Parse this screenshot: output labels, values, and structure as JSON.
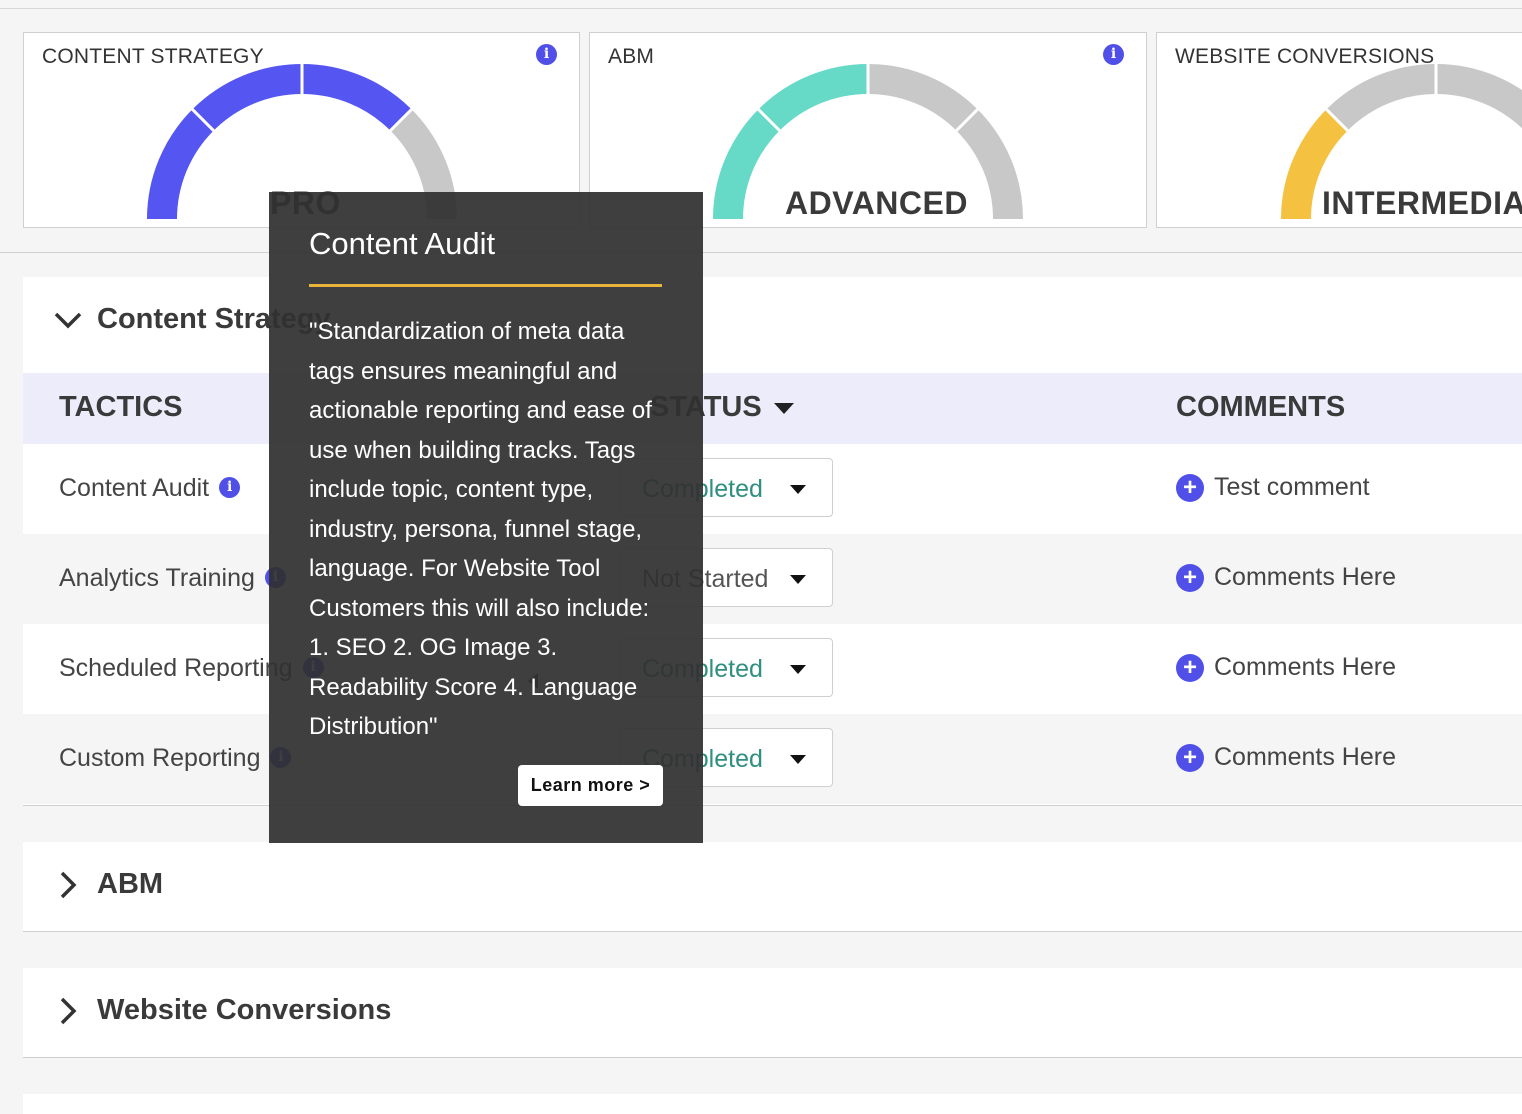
{
  "gauges": [
    {
      "title": "CONTENT STRATEGY",
      "level": "PRO",
      "fill_color": "#5555f2",
      "filled_segments": 3,
      "total_segments": 4
    },
    {
      "title": "ABM",
      "level": "ADVANCED",
      "fill_color": "#66d9c7",
      "filled_segments": 2,
      "total_segments": 4
    },
    {
      "title": "WEBSITE CONVERSIONS",
      "level": "INTERMEDIAT",
      "fill_color": "#f4c240",
      "filled_segments": 1,
      "total_segments": 4
    }
  ],
  "gauge_empty_color": "#c8c8c8",
  "info_glyph": "i",
  "sections": {
    "content_strategy": {
      "title": "Content Strategy",
      "expanded": true,
      "columns": {
        "tactics": "TACTICS",
        "status": "STATUS",
        "comments": "COMMENTS"
      },
      "rows": [
        {
          "tactic": "Content Audit",
          "status": "Completed",
          "comment": "Test comment"
        },
        {
          "tactic": "Analytics Training",
          "status": "Not Started",
          "comment": "Comments Here"
        },
        {
          "tactic": "Scheduled Reporting",
          "status": "Completed",
          "comment": "Comments Here"
        },
        {
          "tactic": "Custom Reporting",
          "status": "Completed",
          "comment": "Comments Here"
        }
      ]
    },
    "abm": {
      "title": "ABM",
      "expanded": false
    },
    "website_conversions": {
      "title": "Website Conversions",
      "expanded": false
    }
  },
  "tooltip": {
    "title": "Content Audit",
    "body": "\"Standardization of meta data tags ensures meaningful and actionable reporting and ease of use when building tracks. Tags include topic, content type, industry, persona, funnel stage, language. For Website Tool Customers this will also include: 1. SEO 2. OG Image 3. Readability Score 4. Language Distribution\"",
    "button": "Learn more  >",
    "accent_color": "#e8b43a"
  },
  "colors": {
    "brand": "#5050e8",
    "completed": "#2f8f80",
    "header_bg": "#ececfb"
  }
}
